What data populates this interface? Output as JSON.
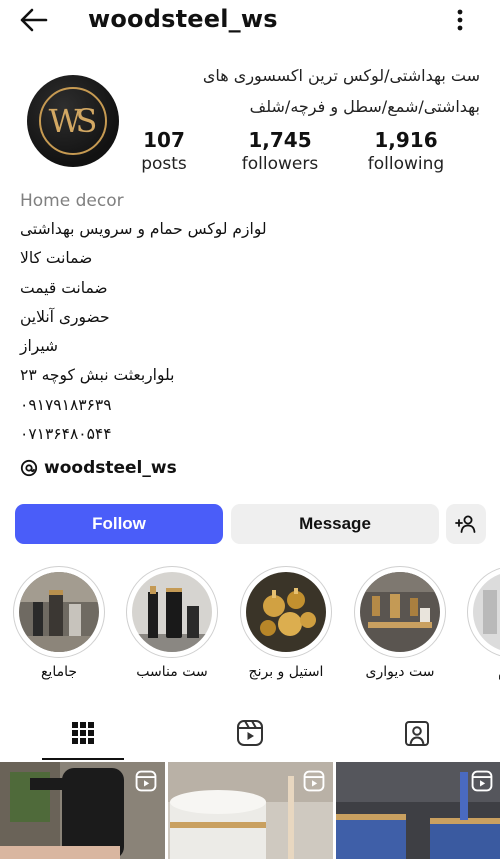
{
  "header": {
    "username": "woodsteel_ws"
  },
  "profile": {
    "name_line1": "ست بهداشتی/لوکس ترین اکسسوری های",
    "name_line2": "بهداشتی/شمع/سطل و فرچه/شلف",
    "avatar_icon": "woodsteel-logo",
    "stats": {
      "posts": {
        "value": "107",
        "label": "posts"
      },
      "followers": {
        "value": "1,745",
        "label": "followers"
      },
      "following": {
        "value": "1,916",
        "label": "following"
      }
    },
    "category": "Home decor",
    "bio": [
      "لوازم لوکس حمام و سرویس بهداشتی",
      "ضمانت کالا",
      "ضمانت قیمت",
      "حضوری آنلاین",
      "شیراز",
      "بلواربعثت نبش کوچه ۲۳",
      "۰۹۱۷۹۱۸۳۶۳۹",
      "۰۷۱۳۶۴۸۰۵۴۴"
    ],
    "threads_handle": "woodsteel_ws"
  },
  "actions": {
    "follow": "Follow",
    "message": "Message"
  },
  "highlights": [
    {
      "label": "جامایع"
    },
    {
      "label": "ست مناسب"
    },
    {
      "label": "استیل و برنج"
    },
    {
      "label": "ست دیواری"
    },
    {
      "label": "حمام"
    }
  ],
  "colors": {
    "follow_button": "#4a5df9",
    "secondary_button": "#efefef",
    "accent_gold": "#c69a52"
  }
}
